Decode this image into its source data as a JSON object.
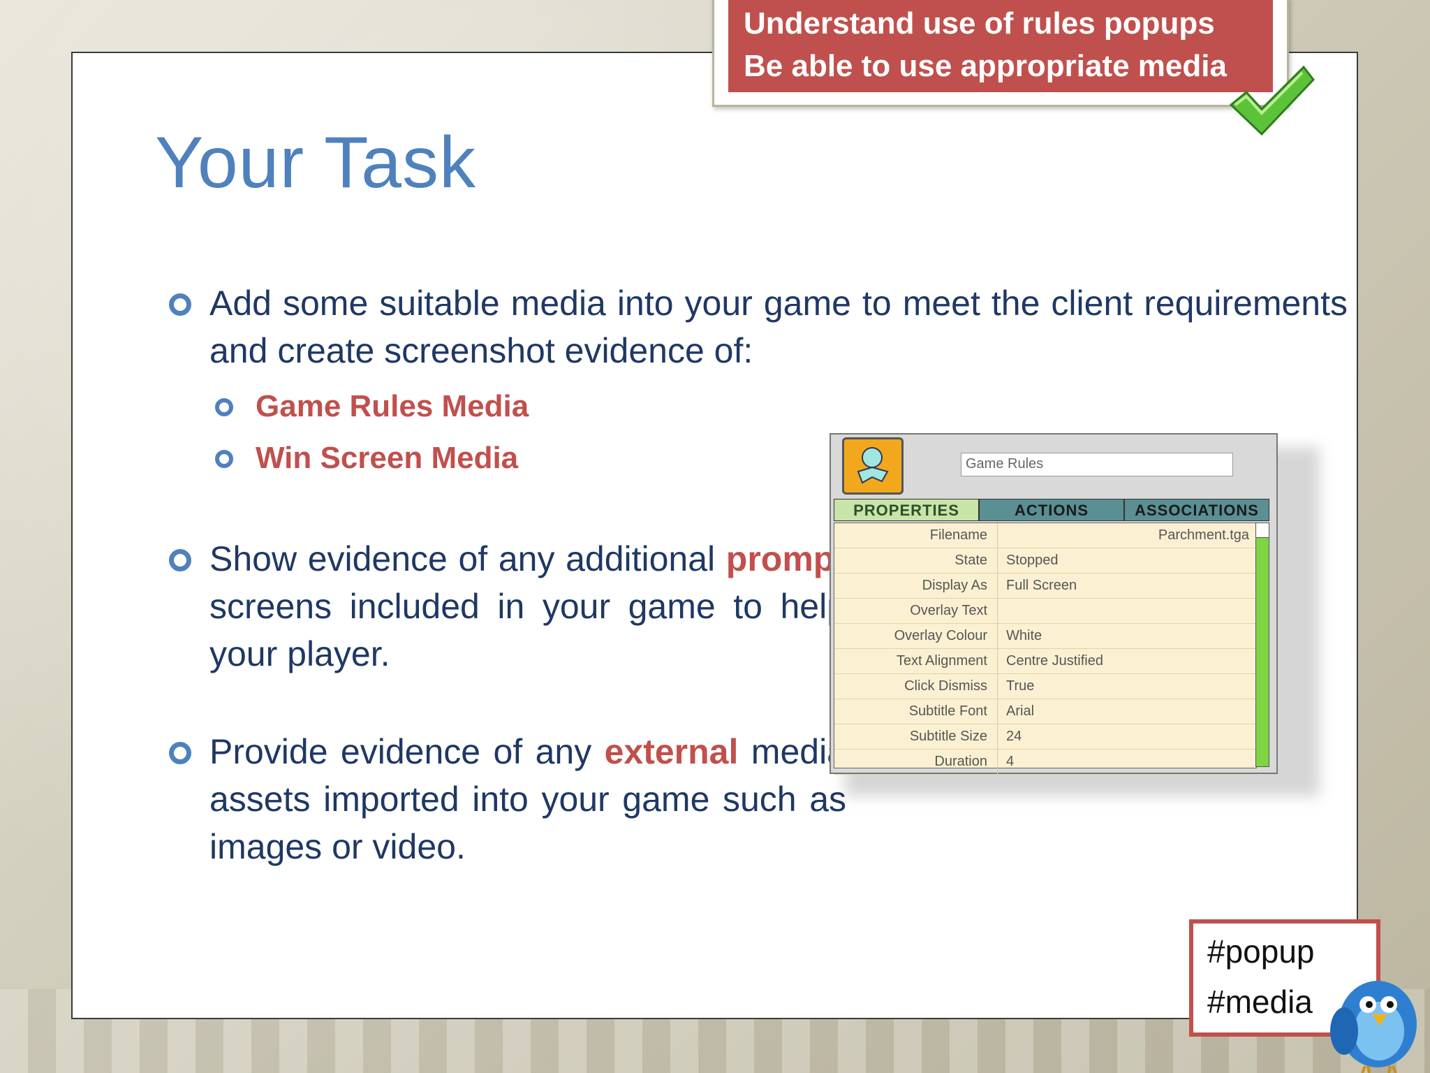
{
  "objectives": {
    "line1": "Understand use of rules popups",
    "line2": "Be able to use appropriate media"
  },
  "title": "Your Task",
  "bullets": {
    "b1": "Add some suitable media into your game to meet the client requirements and create screenshot evidence of:",
    "b1_subs": [
      "Game Rules Media",
      "Win Screen Media"
    ],
    "b2": {
      "pre": "Show evidence of any additional",
      "highlight": "prompt",
      "post": "screens included in your game to help your player."
    },
    "b3": {
      "pre": "Provide evidence of any",
      "highlight": "external",
      "post": "media assets imported into your game such as images or video."
    }
  },
  "properties_panel": {
    "name_field": "Game Rules",
    "tabs": [
      "PROPERTIES",
      "ACTIONS",
      "ASSOCIATIONS"
    ],
    "rows": [
      {
        "key": "Filename",
        "value": "Parchment.tga"
      },
      {
        "key": "State",
        "value": "Stopped"
      },
      {
        "key": "Display As",
        "value": "Full Screen"
      },
      {
        "key": "Overlay Text",
        "value": ""
      },
      {
        "key": "Overlay Colour",
        "value": "White"
      },
      {
        "key": "Text Alignment",
        "value": "Centre Justified"
      },
      {
        "key": "Click Dismiss",
        "value": "True"
      },
      {
        "key": "Subtitle Font",
        "value": "Arial"
      },
      {
        "key": "Subtitle Size",
        "value": "24"
      },
      {
        "key": "Duration",
        "value": "4"
      }
    ]
  },
  "hashtags": [
    "#popup",
    "#media"
  ],
  "colors": {
    "accent_red": "#c0504d",
    "title_blue": "#4f81bd",
    "body_text": "#1f3864"
  },
  "icons": [
    "check-icon",
    "bird-icon",
    "character-icon"
  ]
}
